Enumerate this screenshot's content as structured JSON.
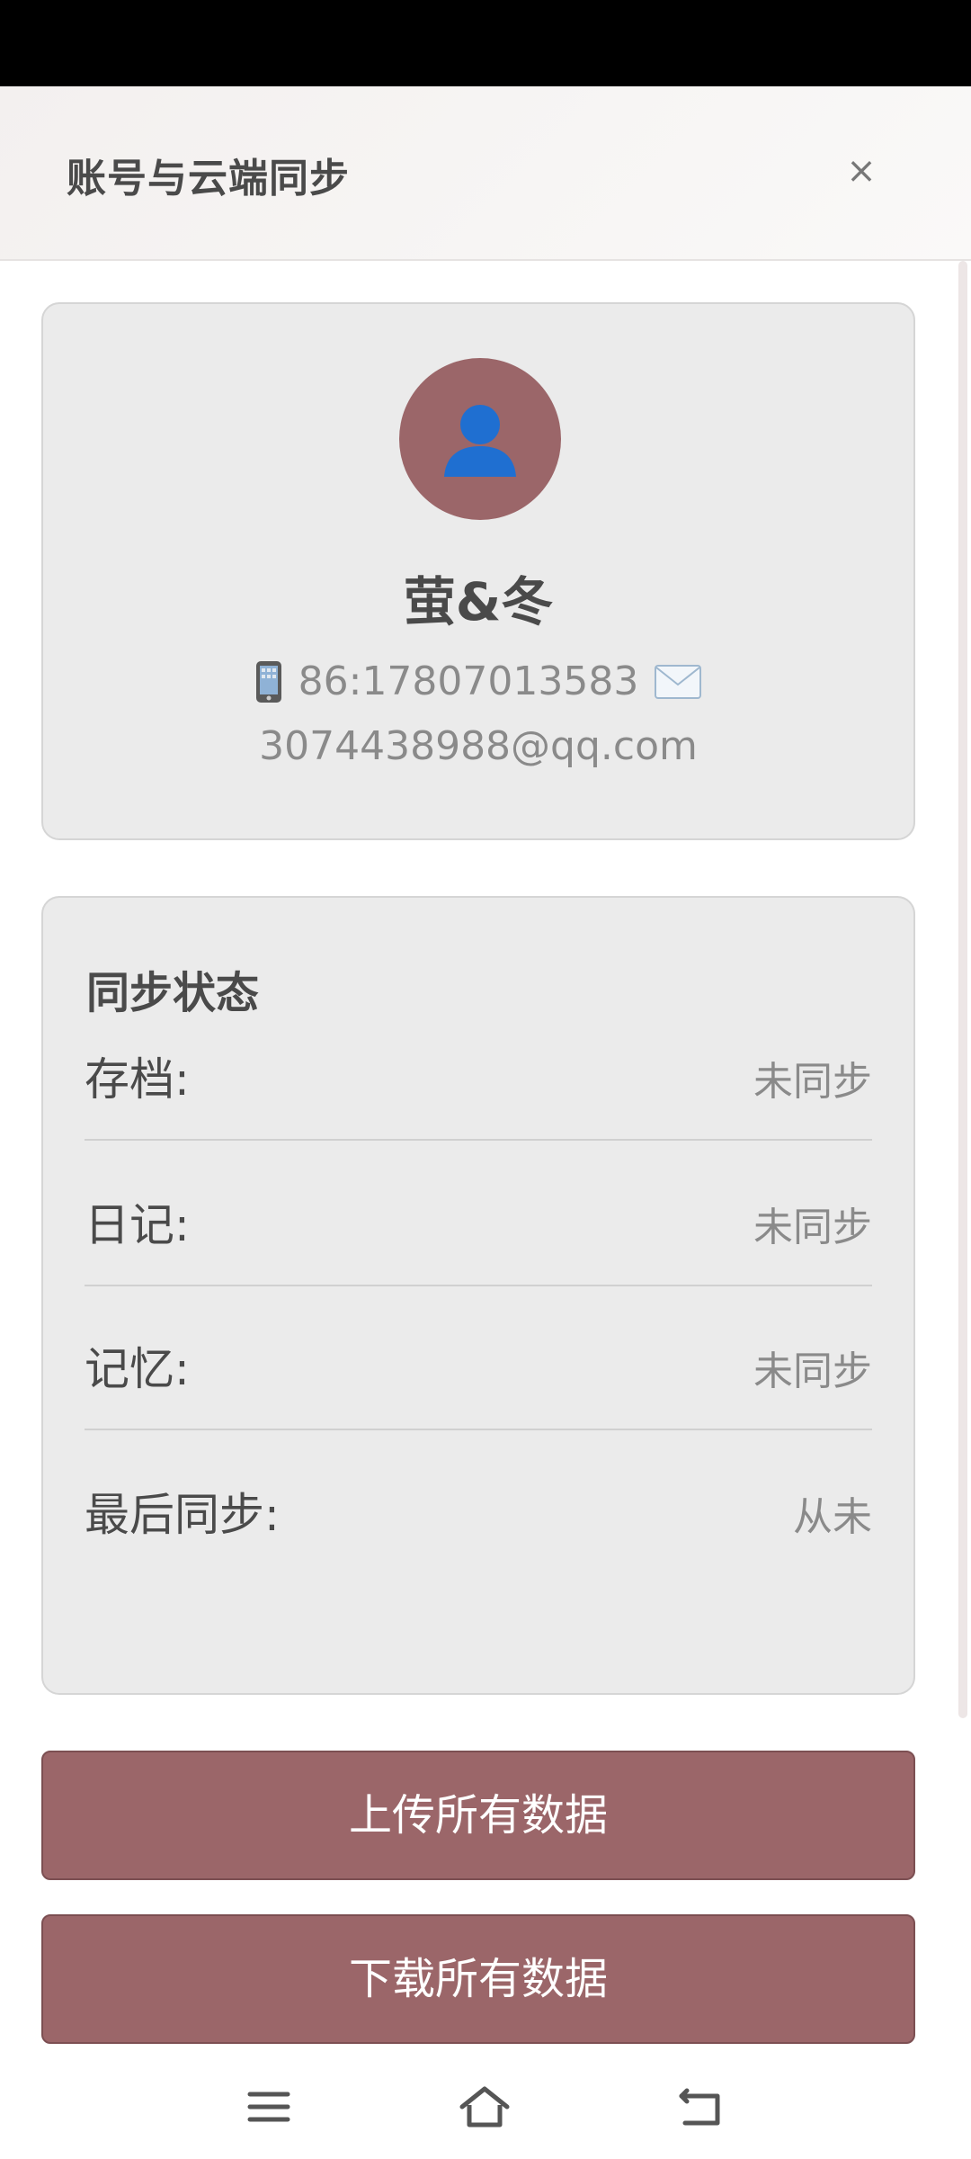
{
  "header": {
    "title": "账号与云端同步",
    "close_label": "×"
  },
  "profile": {
    "avatar_icon": "user-silhouette-icon",
    "name": "萤&冬",
    "phone_icon": "mobile-phone-icon",
    "phone": "86:17807013583",
    "email_icon": "envelope-icon",
    "email": "3074438988@qq.com"
  },
  "sync": {
    "title": "同步状态",
    "rows": [
      {
        "label": "存档:",
        "value": "未同步"
      },
      {
        "label": "日记:",
        "value": "未同步"
      },
      {
        "label": "记忆:",
        "value": "未同步"
      },
      {
        "label": "最后同步:",
        "value": "从未"
      }
    ]
  },
  "actions": {
    "upload_label": "上传所有数据",
    "download_label": "下载所有数据"
  },
  "navbar": {
    "menu_icon": "menu-icon",
    "home_icon": "home-icon",
    "back_icon": "back-icon"
  },
  "colors": {
    "accent": "#9b6669",
    "card_bg": "#ebebeb",
    "text_primary": "#4a4a4a",
    "text_secondary": "#8a8a8a"
  }
}
